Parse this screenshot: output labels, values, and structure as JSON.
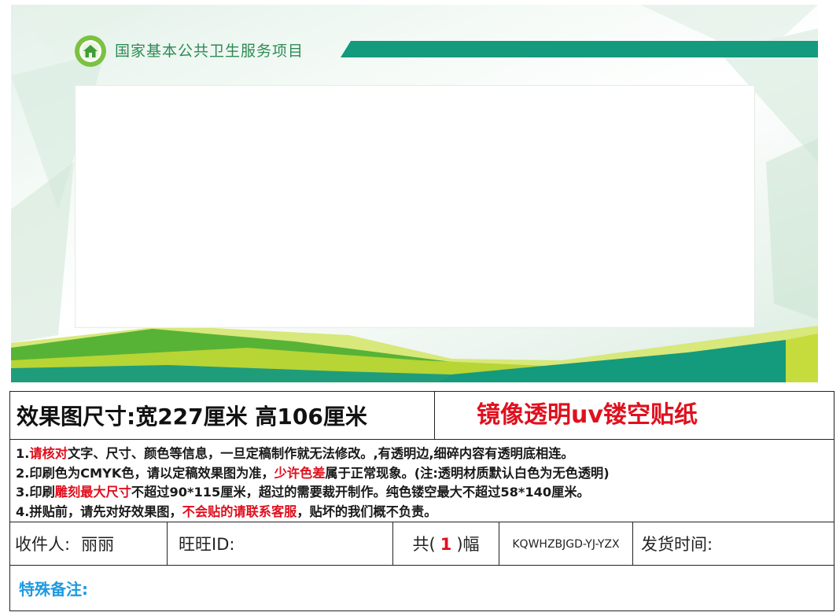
{
  "banner": {
    "title": "国家基本公共卫生服务项目",
    "colors": {
      "teal": "#149a7c",
      "lime": "#b7d534",
      "green": "#57b336",
      "title_green": "#2e8a55"
    }
  },
  "spec": {
    "size_text": "效果图尺寸:宽227厘米  高106厘米",
    "product_name": "镜像透明uv镂空贴纸"
  },
  "notes": {
    "n1_a": "1.",
    "n1_red": "请核对",
    "n1_b": "文字、尺寸、颜色等信息，一旦定稿制作就无法修改。,有透明边,细碎内容有透明底相连。",
    "n2_a": "2.印刷色为CMYK色，请以定稿效果图为准，",
    "n2_red": "少许色差",
    "n2_b": "属于正常现象。(注:透明材质默认白色为无色透明)",
    "n3_a": "3.印刷",
    "n3_red": "雕刻最大尺寸",
    "n3_b": "不超过90*115厘米，超过的需要裁开制作。纯色镂空最大不超过58*140厘米。",
    "n4_a": "4.拼贴前，请先对好效果图，",
    "n4_red": "不会贴的请联系客服",
    "n4_b": "，贴坏的我们概不负责。"
  },
  "order": {
    "recipient_label": "收件人:",
    "recipient_value": "丽丽",
    "wangwang_label": "旺旺ID:",
    "count_prefix": "共(",
    "count_value": "1",
    "count_suffix": ")幅",
    "code": "KQWHZBJGD-YJ-YZX",
    "ship_label": "发货时间:"
  },
  "remark": {
    "label": "特殊备注:"
  },
  "colors": {
    "red": "#e0101e",
    "blue": "#1d9ae0"
  }
}
